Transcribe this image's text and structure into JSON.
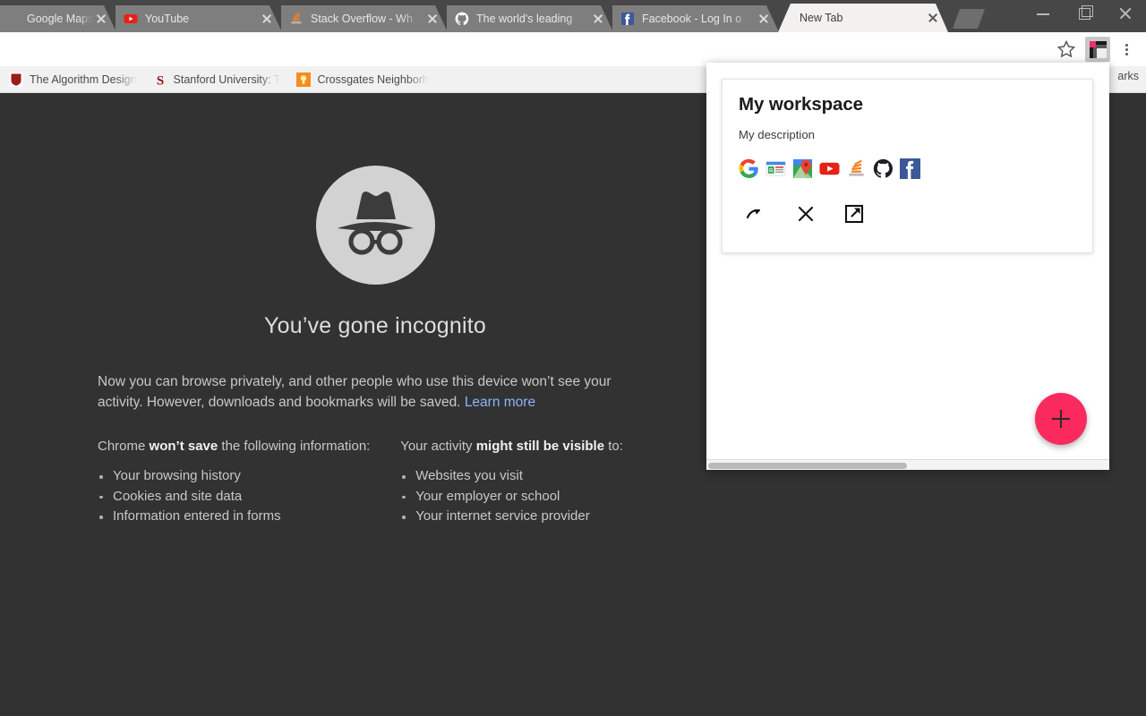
{
  "window": {
    "controls": [
      {
        "name": "minimize",
        "label": "–"
      },
      {
        "name": "maximize",
        "label": "❐"
      },
      {
        "name": "close",
        "label": "✕"
      }
    ]
  },
  "tabs": [
    {
      "title": "Google Maps",
      "icon": "google-maps-favicon",
      "active": false
    },
    {
      "title": "YouTube",
      "icon": "youtube-favicon",
      "active": false
    },
    {
      "title": "Stack Overflow - Wh",
      "icon": "stack-overflow-favicon",
      "active": false
    },
    {
      "title": "The world's leading",
      "icon": "github-favicon",
      "active": false
    },
    {
      "title": "Facebook - Log In o",
      "icon": "facebook-favicon",
      "active": false
    },
    {
      "title": "New Tab",
      "icon": "none",
      "active": true
    }
  ],
  "toolbar": {
    "bookmark_star": "star-icon",
    "extension": "workspaces-extension-icon",
    "menu": "three-dot-menu-icon"
  },
  "bookmarks_bar": {
    "items": [
      {
        "label": "The Algorithm Design",
        "icon": "shield-icon",
        "color": "#9e1b1b"
      },
      {
        "label": "Stanford University: T",
        "icon": "stanford-icon",
        "color": "#8c1515"
      },
      {
        "label": "Crossgates Neighborh",
        "icon": "bulb-icon",
        "color": "#f68b1f"
      }
    ],
    "other_bookmarks": "arks"
  },
  "incognito": {
    "icon": "incognito-spy-icon",
    "title": "You’ve gone incognito",
    "paragraph": "Now you can browse privately, and other people who use this device won’t see your activity. However, downloads and bookmarks will be saved.",
    "learn_more": "Learn more",
    "columns": [
      {
        "heading_pre": "Chrome ",
        "heading_bold": "won’t save",
        "heading_post": " the following information:",
        "items": [
          "Your browsing history",
          "Cookies and site data",
          "Information entered in forms"
        ]
      },
      {
        "heading_pre": "Your activity ",
        "heading_bold": "might still be visible",
        "heading_post": " to:",
        "items": [
          "Websites you visit",
          "Your employer or school",
          "Your internet service provider"
        ]
      }
    ]
  },
  "popup": {
    "workspace": {
      "title": "My workspace",
      "description": "My description",
      "favicons": [
        {
          "name": "google-favicon"
        },
        {
          "name": "google-news-favicon"
        },
        {
          "name": "google-maps-favicon"
        },
        {
          "name": "youtube-favicon"
        },
        {
          "name": "stack-overflow-favicon"
        },
        {
          "name": "github-favicon"
        },
        {
          "name": "facebook-favicon"
        }
      ],
      "actions": [
        {
          "name": "restore-workspace-icon",
          "label": "restore"
        },
        {
          "name": "close-workspace-icon",
          "label": "close"
        },
        {
          "name": "open-in-new-window-icon",
          "label": "open"
        }
      ]
    },
    "add_button": {
      "name": "add-workspace-fab",
      "label": "+",
      "color": "#fa2a5e"
    }
  }
}
